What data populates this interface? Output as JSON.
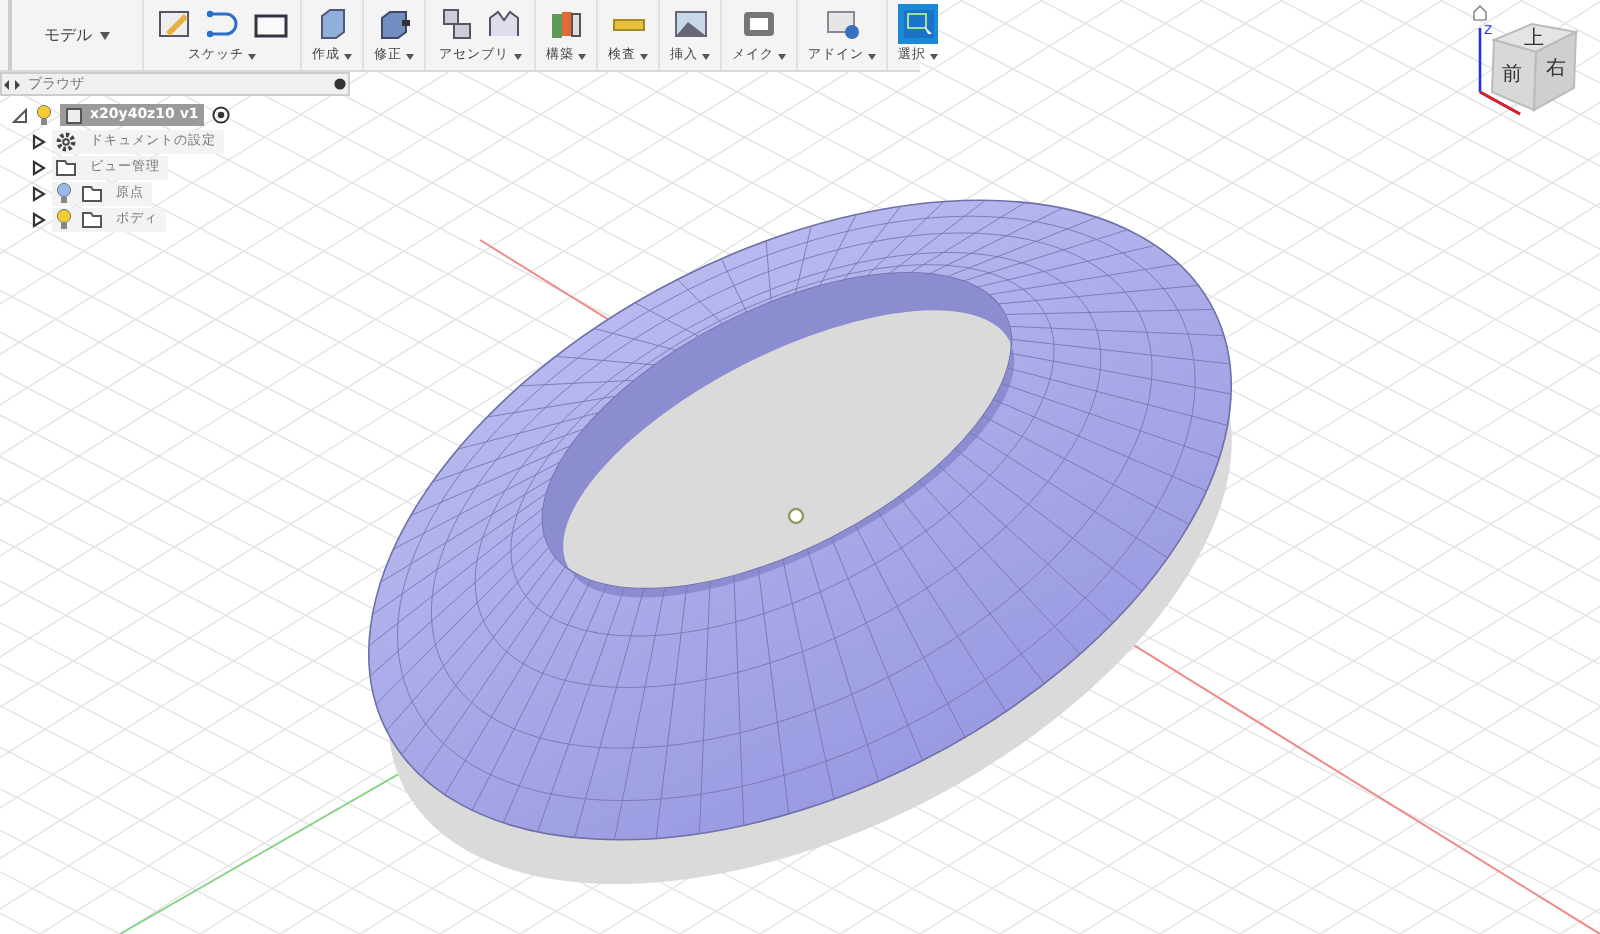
{
  "toolbar": {
    "workspace": "モデル",
    "groups": [
      {
        "label": "スケッチ",
        "selected": false
      },
      {
        "label": "作成",
        "selected": false
      },
      {
        "label": "修正",
        "selected": false
      },
      {
        "label": "アセンブリ",
        "selected": false
      },
      {
        "label": "構築",
        "selected": false
      },
      {
        "label": "検査",
        "selected": false
      },
      {
        "label": "挿入",
        "selected": false
      },
      {
        "label": "メイク",
        "selected": false
      },
      {
        "label": "アドイン",
        "selected": false
      },
      {
        "label": "選択",
        "selected": true
      }
    ]
  },
  "browser": {
    "title": "ブラウザ",
    "root": {
      "label": "x20y40z10 v1",
      "expanded": true,
      "visible": true,
      "children": [
        {
          "label": "ドキュメントの設定",
          "kind": "settings",
          "expanded": false
        },
        {
          "label": "ビュー管理",
          "kind": "folder",
          "expanded": false
        },
        {
          "label": "原点",
          "kind": "folder",
          "expanded": false,
          "visible": false
        },
        {
          "label": "ボディ",
          "kind": "folder",
          "expanded": false,
          "visible": true
        }
      ]
    }
  },
  "view_cube": {
    "axis": "Z",
    "faces": [
      {
        "label": "上",
        "kind": "top"
      },
      {
        "label": "前",
        "kind": "front"
      },
      {
        "label": "右",
        "kind": "right"
      }
    ]
  }
}
